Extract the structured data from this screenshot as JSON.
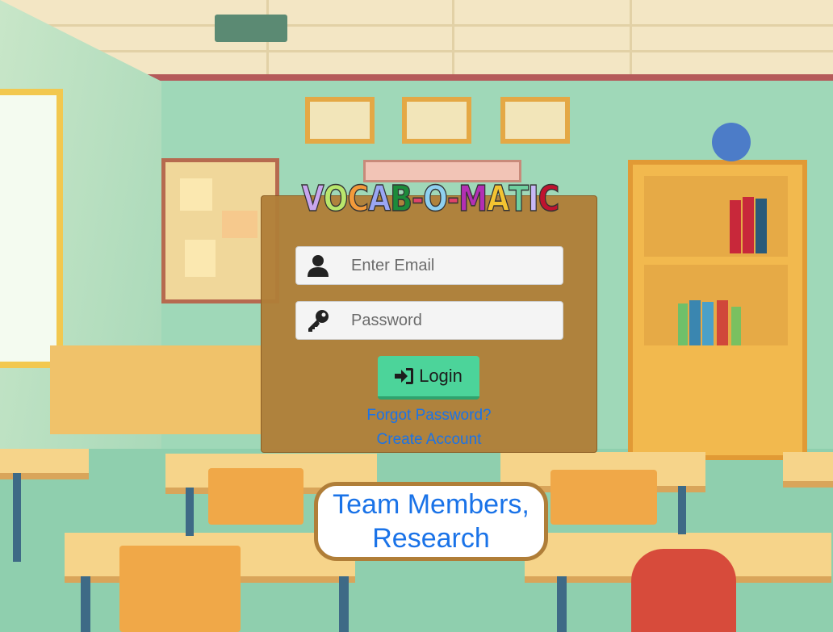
{
  "logo": {
    "letters": [
      {
        "ch": "V",
        "color": "#c9a6ef"
      },
      {
        "ch": "O",
        "color": "#b9e66c"
      },
      {
        "ch": "C",
        "color": "#f39a3a"
      },
      {
        "ch": "A",
        "color": "#9aa6f4"
      },
      {
        "ch": "B",
        "color": "#1c8b3a"
      },
      {
        "ch": "-",
        "color": "#e0436a"
      },
      {
        "ch": "O",
        "color": "#8fd0f0"
      },
      {
        "ch": "-",
        "color": "#e0436a"
      },
      {
        "ch": "M",
        "color": "#b32fb4"
      },
      {
        "ch": "A",
        "color": "#f3c431"
      },
      {
        "ch": "T",
        "color": "#6fd0a0"
      },
      {
        "ch": "I",
        "color": "#c7b8f7"
      },
      {
        "ch": "C",
        "color": "#c0132f"
      }
    ]
  },
  "login": {
    "email_placeholder": "Enter Email",
    "password_placeholder": "Password",
    "login_label": "Login",
    "forgot_label": "Forgot Password?",
    "create_label": "Create Account"
  },
  "team": {
    "line1": "Team Members,",
    "line2": "Research"
  },
  "colors": {
    "card": "#b07e38",
    "button": "#4cd49a",
    "link": "#1a73e8"
  }
}
